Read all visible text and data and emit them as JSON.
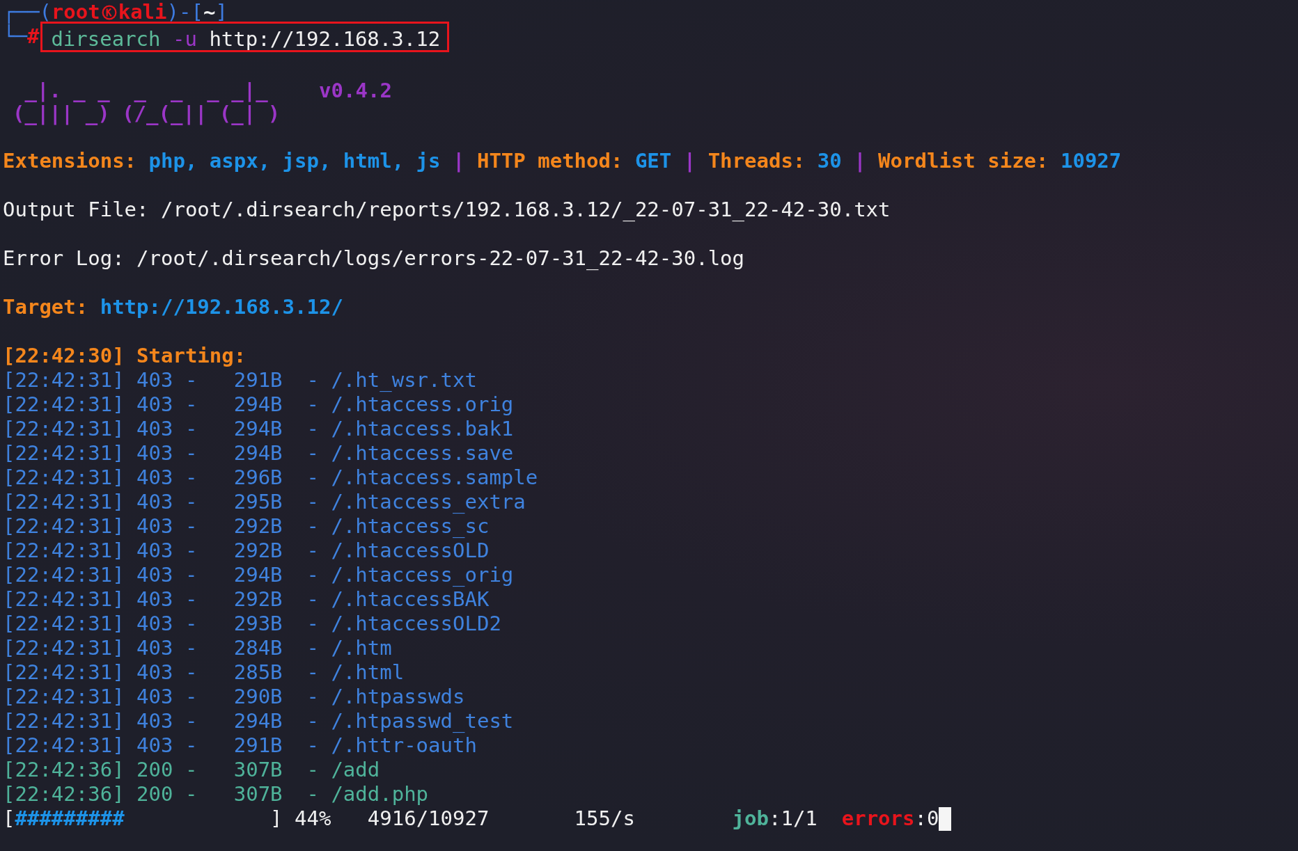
{
  "prompt": {
    "frame_top": "┌──(",
    "user": "root",
    "host": "kali",
    "frame_mid": ")-[",
    "directory": "~",
    "frame_end": "]",
    "frame_bottom": "└─",
    "symbol": "#"
  },
  "command": {
    "program": "dirsearch",
    "flag": "-u",
    "argument": "http://192.168.3.12",
    "highlighted": true
  },
  "banner": {
    "art_lines": [
      " _|. _ _  _  _  _ _|_",
      "(_||| _) (/_(_|| (_| )"
    ],
    "version": "v0.4.2"
  },
  "settings": [
    {
      "label": "Extensions:",
      "value": "php, aspx, jsp, html, js"
    },
    {
      "label": "HTTP method:",
      "value": "GET"
    },
    {
      "label": "Threads:",
      "value": "30"
    },
    {
      "label": "Wordlist size:",
      "value": "10927"
    }
  ],
  "separator": "|",
  "output_file": "Output File: /root/.dirsearch/reports/192.168.3.12/_22-07-31_22-42-30.txt",
  "error_log": "Error Log: /root/.dirsearch/logs/errors-22-07-31_22-42-30.log",
  "target": {
    "label": "Target:",
    "url": "http://192.168.3.12/"
  },
  "starting": "[22:42:30] Starting:",
  "results": [
    {
      "kind": "forbidden",
      "text": "[22:42:31] 403 -   291B  - /.ht_wsr.txt"
    },
    {
      "kind": "forbidden",
      "text": "[22:42:31] 403 -   294B  - /.htaccess.orig"
    },
    {
      "kind": "forbidden",
      "text": "[22:42:31] 403 -   294B  - /.htaccess.bak1"
    },
    {
      "kind": "forbidden",
      "text": "[22:42:31] 403 -   294B  - /.htaccess.save"
    },
    {
      "kind": "forbidden",
      "text": "[22:42:31] 403 -   296B  - /.htaccess.sample"
    },
    {
      "kind": "forbidden",
      "text": "[22:42:31] 403 -   295B  - /.htaccess_extra"
    },
    {
      "kind": "forbidden",
      "text": "[22:42:31] 403 -   292B  - /.htaccess_sc"
    },
    {
      "kind": "forbidden",
      "text": "[22:42:31] 403 -   292B  - /.htaccessOLD"
    },
    {
      "kind": "forbidden",
      "text": "[22:42:31] 403 -   294B  - /.htaccess_orig"
    },
    {
      "kind": "forbidden",
      "text": "[22:42:31] 403 -   292B  - /.htaccessBAK"
    },
    {
      "kind": "forbidden",
      "text": "[22:42:31] 403 -   293B  - /.htaccessOLD2"
    },
    {
      "kind": "forbidden",
      "text": "[22:42:31] 403 -   284B  - /.htm"
    },
    {
      "kind": "forbidden",
      "text": "[22:42:31] 403 -   285B  - /.html"
    },
    {
      "kind": "forbidden",
      "text": "[22:42:31] 403 -   290B  - /.htpasswds"
    },
    {
      "kind": "forbidden",
      "text": "[22:42:31] 403 -   294B  - /.htpasswd_test"
    },
    {
      "kind": "forbidden",
      "text": "[22:42:31] 403 -   291B  - /.httr-oauth"
    },
    {
      "kind": "ok",
      "text": "[22:42:36] 200 -   307B  - /add"
    },
    {
      "kind": "ok",
      "text": "[22:42:36] 200 -   307B  - /add.php"
    }
  ],
  "progress": {
    "open": "[",
    "bar": "#########",
    "close": "]",
    "percent": "44%",
    "count": "4916/10927",
    "rate": "155/s",
    "job_label": "job",
    "job_value": ":1/1",
    "errors_label": "errors",
    "errors_value": ":0"
  }
}
